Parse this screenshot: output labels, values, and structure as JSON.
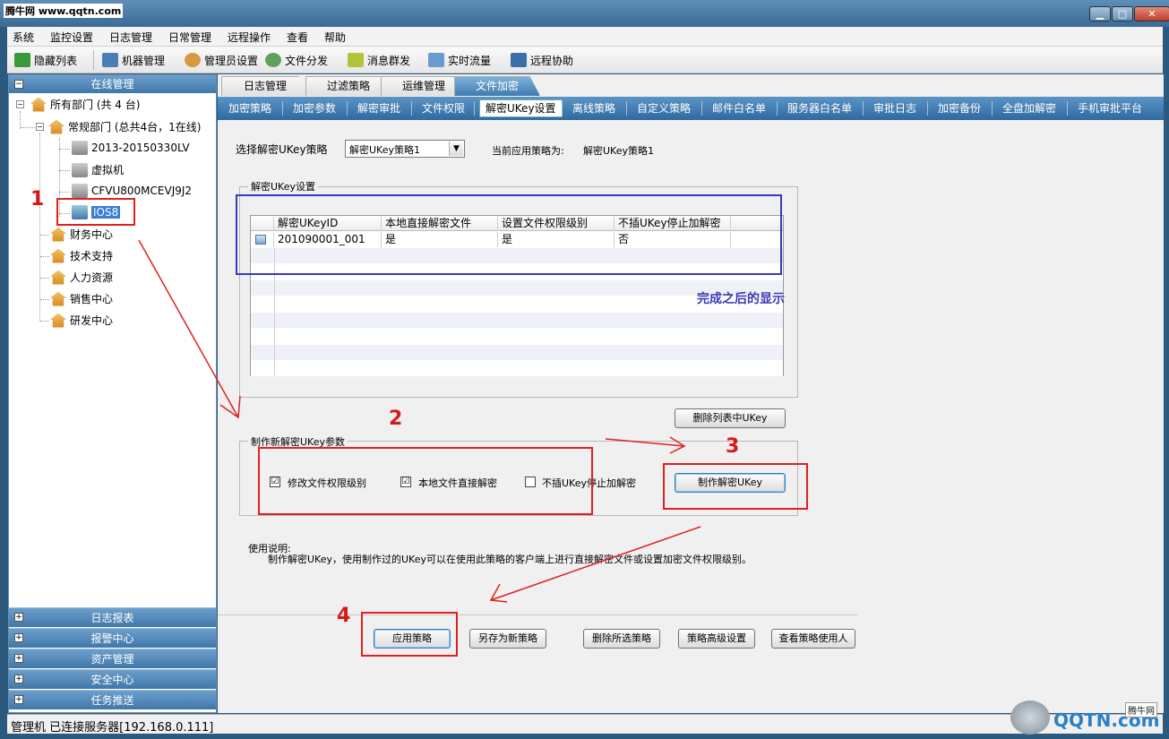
{
  "window": {
    "title": "腾牛网 www.qqtn.com"
  },
  "menu": [
    "系统",
    "监控设置",
    "日志管理",
    "日常管理",
    "远程操作",
    "查看",
    "帮助"
  ],
  "toolbar": [
    "隐藏列表",
    "机器管理",
    "管理员设置",
    "文件分发",
    "消息群发",
    "实时流量",
    "远程协助"
  ],
  "left": {
    "header": "在线管理",
    "tree": {
      "root": "所有部门 (共 4 台)",
      "dept": "常规部门 (总共4台，1在线)",
      "machines": [
        "2013-20150330LV",
        "虚拟机",
        "CFVU800MCEVJ9J2",
        "IOS8"
      ],
      "others": [
        "财务中心",
        "技术支持",
        "人力资源",
        "销售中心",
        "研发中心"
      ]
    },
    "accordion": [
      "日志报表",
      "报警中心",
      "资产管理",
      "安全中心",
      "任务推送"
    ]
  },
  "tabs": [
    "日志管理",
    "过滤策略",
    "运维管理",
    "文件加密"
  ],
  "subtabs": [
    "加密策略",
    "加密参数",
    "解密审批",
    "文件权限",
    "解密UKey设置",
    "离线策略",
    "自定义策略",
    "邮件白名单",
    "服务器白名单",
    "审批日志",
    "加密备份",
    "全盘加解密",
    "手机审批平台"
  ],
  "policy": {
    "select_label": "选择解密UKey策略",
    "select_value": "解密UKey策略1",
    "current_label": "当前应用策略为:",
    "current_value": "解密UKey策略1"
  },
  "ukey_group": {
    "title": "解密UKey设置",
    "columns": [
      "解密UKeyID",
      "本地直接解密文件",
      "设置文件权限级别",
      "不插UKey停止加解密"
    ],
    "rows": [
      [
        "201090001_001",
        "是",
        "是",
        "否"
      ]
    ],
    "delete_button": "删除列表中UKey"
  },
  "annotation_text": "完成之后的显示",
  "make_group": {
    "title": "制作新解密UKey参数",
    "options": [
      {
        "label": "修改文件权限级别",
        "checked": "☑"
      },
      {
        "label": "本地文件直接解密",
        "checked": "☑"
      },
      {
        "label": "不插UKey停止加解密",
        "checked": ""
      }
    ],
    "make_button": "制作解密UKey"
  },
  "usage": {
    "title": "使用说明:",
    "text": "制作解密UKey，使用制作过的UKey可以在使用此策略的客户端上进行直接解密文件或设置加密文件权限级别。"
  },
  "bottom_buttons": [
    "应用策略",
    "另存为新策略",
    "删除所选策略",
    "策略高级设置",
    "查看策略使用人"
  ],
  "step_numbers": [
    "1",
    "2",
    "3",
    "4"
  ],
  "status": "管理机   已连接服务器[192.168.0.111]",
  "watermark": {
    "badge": "腾牛网",
    "logo": "QQTN.com"
  },
  "colors": {
    "accent": "#3f77aa",
    "annotation_red": "#e02020",
    "annotation_blue": "#3a3ab8"
  }
}
